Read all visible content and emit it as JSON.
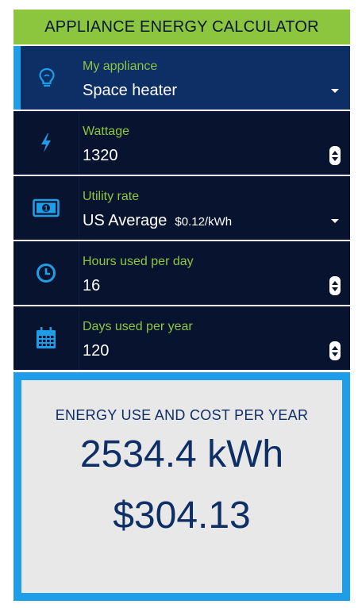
{
  "header": {
    "title": "APPLIANCE ENERGY CALCULATOR"
  },
  "fields": {
    "appliance": {
      "label": "My appliance",
      "value": "Space heater",
      "icon": "lightbulb-icon"
    },
    "wattage": {
      "label": "Wattage",
      "value": "1320",
      "icon": "lightning-icon"
    },
    "utility": {
      "label": "Utility rate",
      "value": "US Average",
      "rate": "$0.12/kWh",
      "icon": "money-icon"
    },
    "hours": {
      "label": "Hours used per day",
      "value": "16",
      "icon": "clock-icon"
    },
    "days": {
      "label": "Days used per year",
      "value": "120",
      "icon": "calendar-icon"
    }
  },
  "result": {
    "title": "ENERGY USE AND COST PER YEAR",
    "energy": "2534.4 kWh",
    "cost": "$304.13"
  },
  "colors": {
    "accent_green": "#8cc63f",
    "accent_blue": "#1e9ee8",
    "row_bg": "#08142f",
    "selected_row_bg": "#0e2e66",
    "result_bg": "#e8e8e8"
  }
}
